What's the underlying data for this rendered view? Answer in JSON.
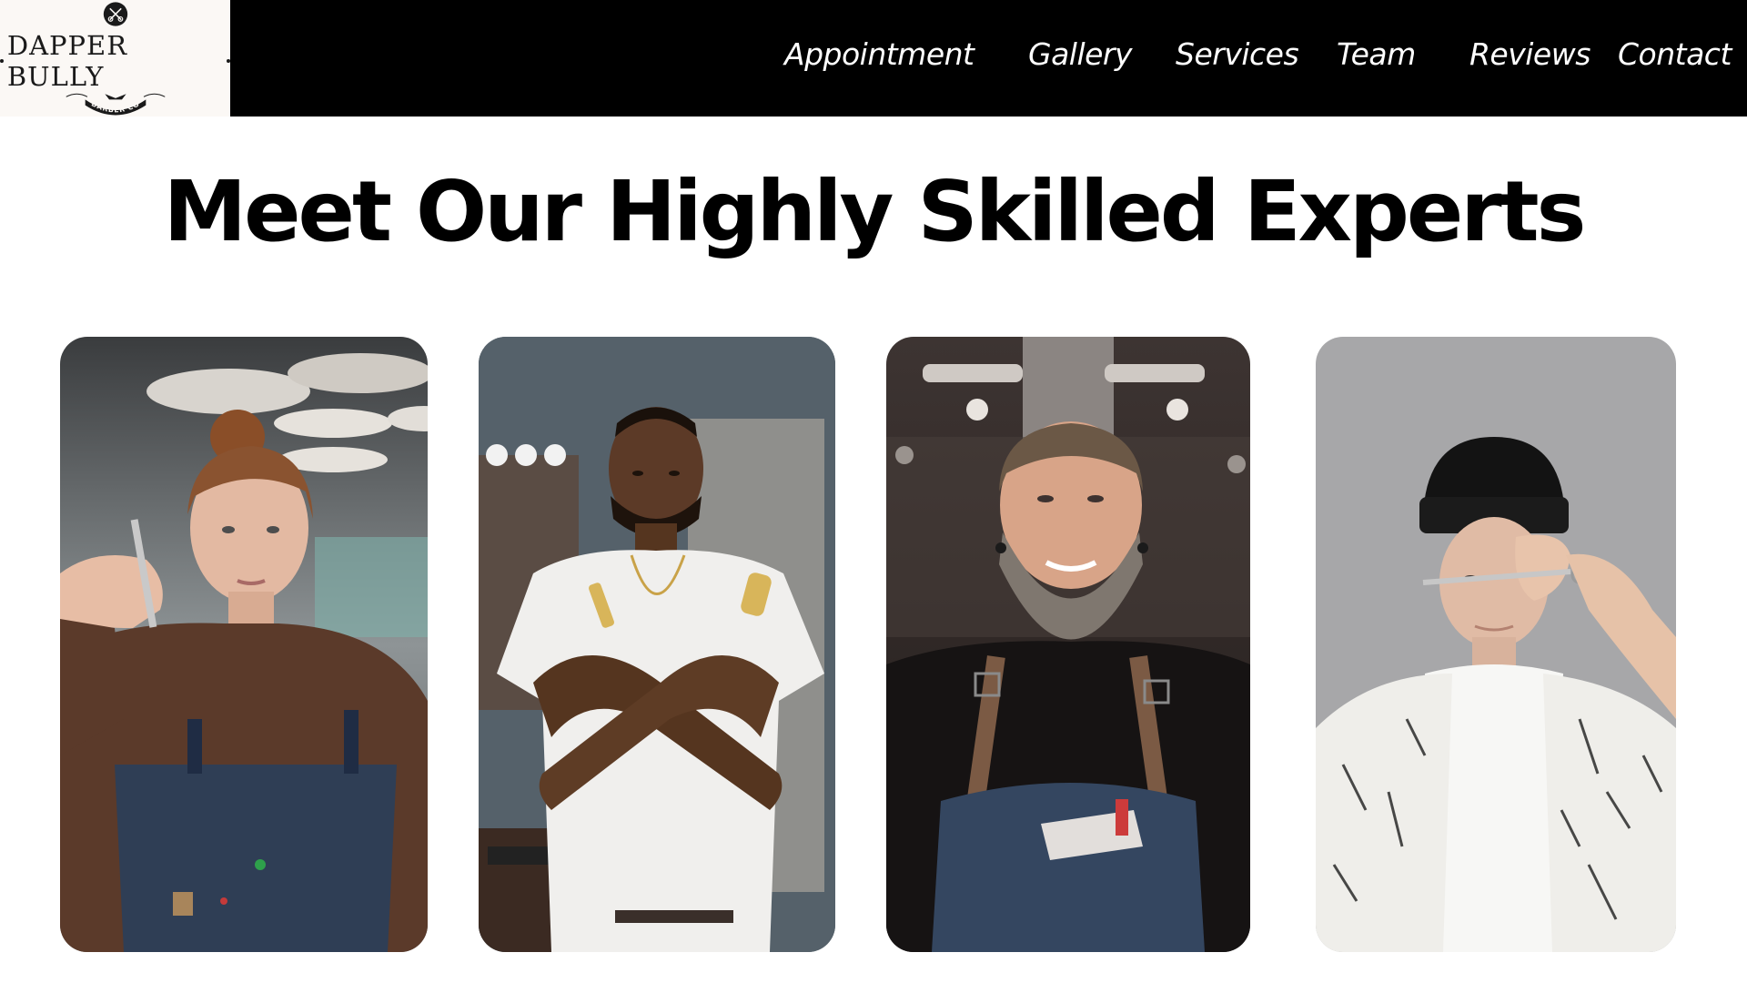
{
  "brand": {
    "name": "DAPPER BULLY",
    "tagline": "BARBER CO",
    "logo_bg": "#fbf8f5"
  },
  "nav": {
    "items": [
      {
        "label": "Appointment"
      },
      {
        "label": "Gallery"
      },
      {
        "label": "Services"
      },
      {
        "label": "Team"
      },
      {
        "label": "Reviews"
      },
      {
        "label": "Contact"
      }
    ],
    "bg": "#000000",
    "text_color": "#ffffff"
  },
  "team": {
    "title": "Meet Our Highly Skilled Experts",
    "members": [
      {
        "photo": "barber-woman-with-scissors-photo"
      },
      {
        "photo": "barber-man-with-clippers-photo"
      },
      {
        "photo": "barber-bearded-man-apron-photo"
      },
      {
        "photo": "barber-man-beanie-scissors-photo"
      }
    ]
  }
}
